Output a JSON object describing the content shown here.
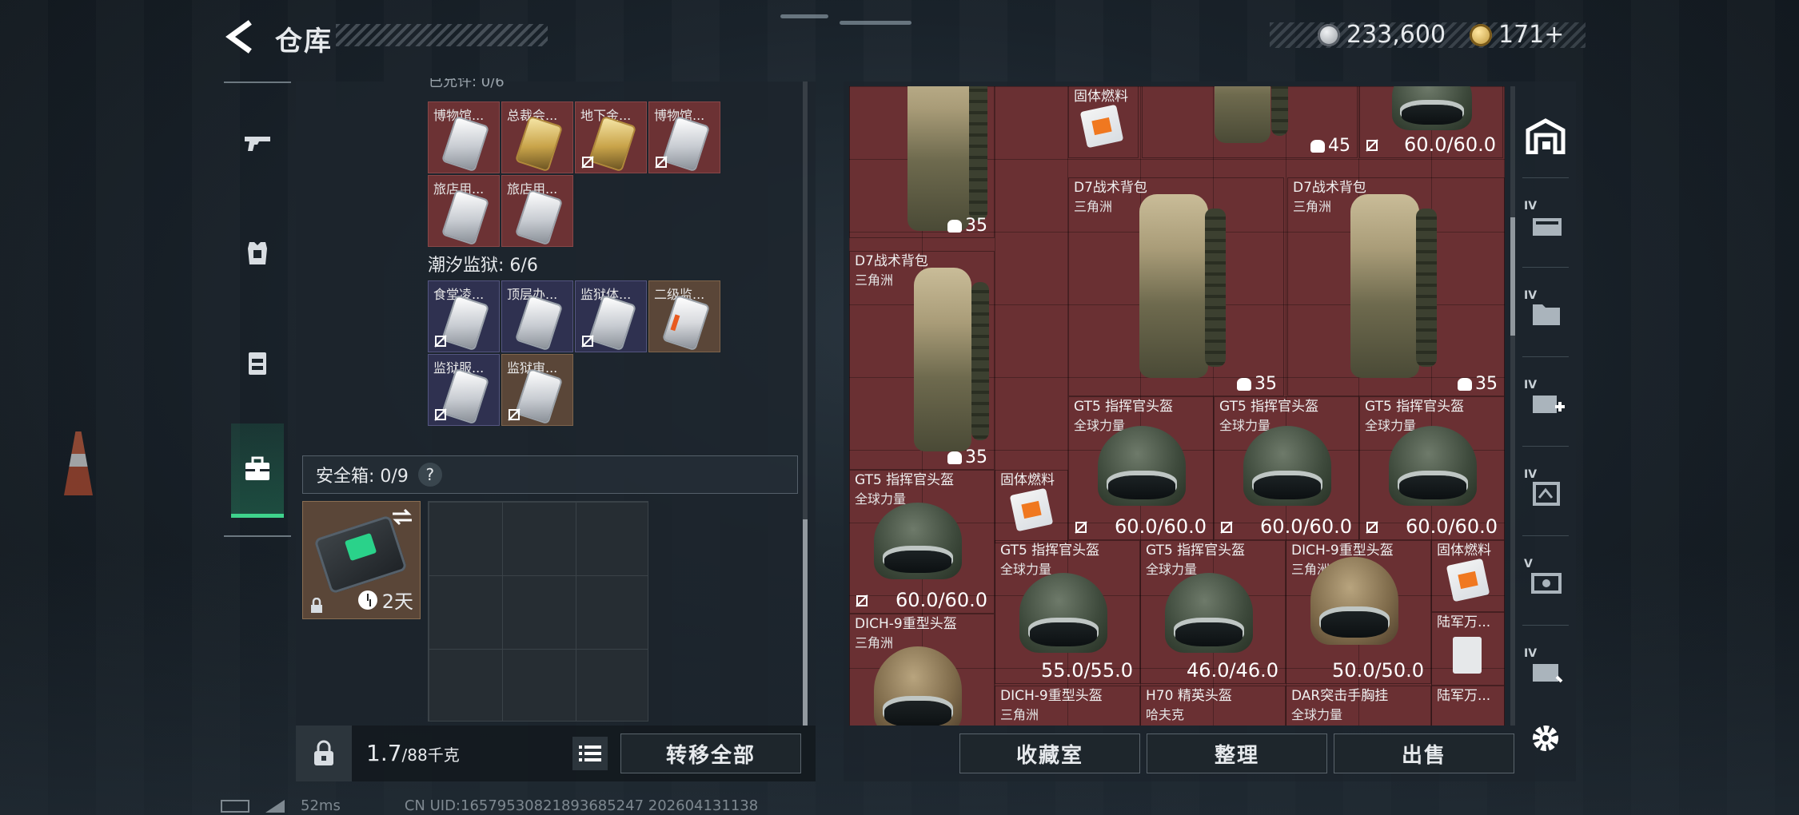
{
  "header": {
    "title": "仓库",
    "currency": [
      {
        "icon": "silver-coin-icon",
        "value": "233,600"
      },
      {
        "icon": "gold-coin-icon",
        "value": "171+"
      }
    ]
  },
  "left_tabs": [
    {
      "icon": "pistol-icon"
    },
    {
      "icon": "armor-vest-icon"
    },
    {
      "icon": "chest-rig-icon"
    },
    {
      "icon": "briefcase-icon",
      "active": true
    }
  ],
  "stash": {
    "partial_label": "已允许: 0/6",
    "group1": [
      {
        "name": "博物馆...",
        "card": "silver"
      },
      {
        "name": "总裁会...",
        "card": "gold"
      },
      {
        "name": "地下金...",
        "card": "gold"
      },
      {
        "name": "博物馆...",
        "card": "silver"
      },
      {
        "name": "旅店用...",
        "card": "silver"
      },
      {
        "name": "旅店用...",
        "card": "silver"
      }
    ],
    "group2_title": "潮汐监狱: 6/6",
    "group2": [
      {
        "name": "食堂凌...",
        "card": "silver"
      },
      {
        "name": "顶层办...",
        "card": "silver"
      },
      {
        "name": "监狱体...",
        "card": "silver"
      },
      {
        "name": "二级监...",
        "card": "orange"
      },
      {
        "name": "监狱服...",
        "card": "silver"
      },
      {
        "name": "监狱审...",
        "card": "silver"
      }
    ]
  },
  "safe": {
    "label": "安全箱: 0/9",
    "help": "?",
    "duration": "2天"
  },
  "bottom_left": {
    "weight": "1.7",
    "weight_max": "/88千克",
    "transfer_all": "转移全部"
  },
  "items": {
    "fuel_1": {
      "name": "固体燃料"
    },
    "bp_top_weight": "45",
    "helmet_top_val": "60.0/60.0",
    "bp_left_weight": "35",
    "bp_d7_1": {
      "name": "D7战术背包",
      "sub": "三角洲",
      "weight": "35"
    },
    "bp_d7_2": {
      "name": "D7战术背包",
      "sub": "三角洲",
      "weight": "35"
    },
    "bp_d7_3": {
      "name": "D7战术背包",
      "sub": "三角洲",
      "weight": "35"
    },
    "gt5_1": {
      "name": "GT5 指挥官头盔",
      "sub": "全球力量",
      "val": "60.0/60.0"
    },
    "gt5_2": {
      "name": "GT5 指挥官头盔",
      "sub": "全球力量",
      "val": "60.0/60.0"
    },
    "gt5_3": {
      "name": "GT5 指挥官头盔",
      "sub": "全球力量",
      "val": "60.0/60.0"
    },
    "gt5_4": {
      "name": "GT5 指挥官头盔",
      "sub": "全球力量",
      "val": "60.0/60.0"
    },
    "fuel_2": {
      "name": "固体燃料"
    },
    "gt5_5": {
      "name": "GT5 指挥官头盔",
      "sub": "全球力量",
      "val": "55.0/55.0"
    },
    "gt5_6": {
      "name": "GT5 指挥官头盔",
      "sub": "全球力量",
      "val": "46.0/46.0"
    },
    "dich_1": {
      "name": "DICH-9重型头盔",
      "sub": "三角洲",
      "val": "50.0/50.0"
    },
    "fuel_3": {
      "name": "固体燃料"
    },
    "dich_2": {
      "name": "DICH-9重型头盔",
      "sub": "三角洲"
    },
    "army_1": {
      "name": "陆军万..."
    },
    "dich_3": {
      "name": "DICH-9重型头盔",
      "sub": "三角洲"
    },
    "h70": {
      "name": "H70 精英头盔",
      "sub": "哈夫克"
    },
    "dar": {
      "name": "DAR突击手胸挂",
      "sub": "全球力量"
    },
    "army_2": {
      "name": "陆军万..."
    }
  },
  "bottom_right": {
    "collection": "收藏室",
    "sort": "整理",
    "sell": "出售"
  },
  "right_tabs": [
    {
      "icon": "warehouse-icon",
      "tier": ""
    },
    {
      "icon": "storage-crate-icon",
      "tier": "IV"
    },
    {
      "icon": "folder-storage-icon",
      "tier": "IV"
    },
    {
      "icon": "medical-storage-icon",
      "tier": "IV"
    },
    {
      "icon": "ammo-storage-icon",
      "tier": "IV"
    },
    {
      "icon": "key-storage-icon",
      "tier": "V"
    },
    {
      "icon": "misc-storage-icon",
      "tier": "IV"
    },
    {
      "icon": "settings-gear-icon",
      "tier": ""
    }
  ],
  "footer": {
    "ping": "52ms",
    "uid": "CN UID:16579530821893685247 202604131138"
  }
}
